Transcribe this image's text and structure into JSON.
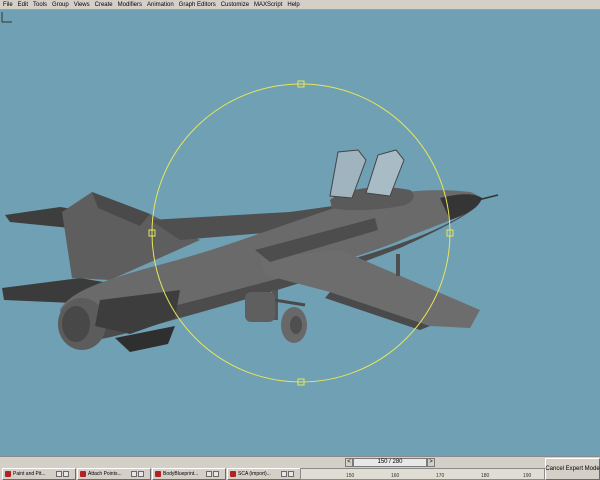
{
  "menu": {
    "items": [
      "File",
      "Edit",
      "Tools",
      "Group",
      "Views",
      "Create",
      "Modifiers",
      "Animation",
      "Graph Editors",
      "Customize",
      "MAXScript",
      "Help"
    ]
  },
  "viewport": {
    "background": "#6fa0b4",
    "selection_gizmo_color": "#e8e65a",
    "object": "jet-aircraft-model"
  },
  "timeslider": {
    "frame_label": "150 / 280",
    "prev_arrow": "<",
    "next_arrow": ">"
  },
  "taskbar": {
    "buttons": [
      {
        "label": "Paint and Pit..."
      },
      {
        "label": "Attach Points..."
      },
      {
        "label": "BodyBlueprint..."
      },
      {
        "label": "SCA (import)..."
      }
    ]
  },
  "trackbar": {
    "ticks": [
      "150",
      "160",
      "170",
      "180",
      "190"
    ]
  },
  "expert_mode": {
    "label": "Cancel Expert Mode"
  }
}
